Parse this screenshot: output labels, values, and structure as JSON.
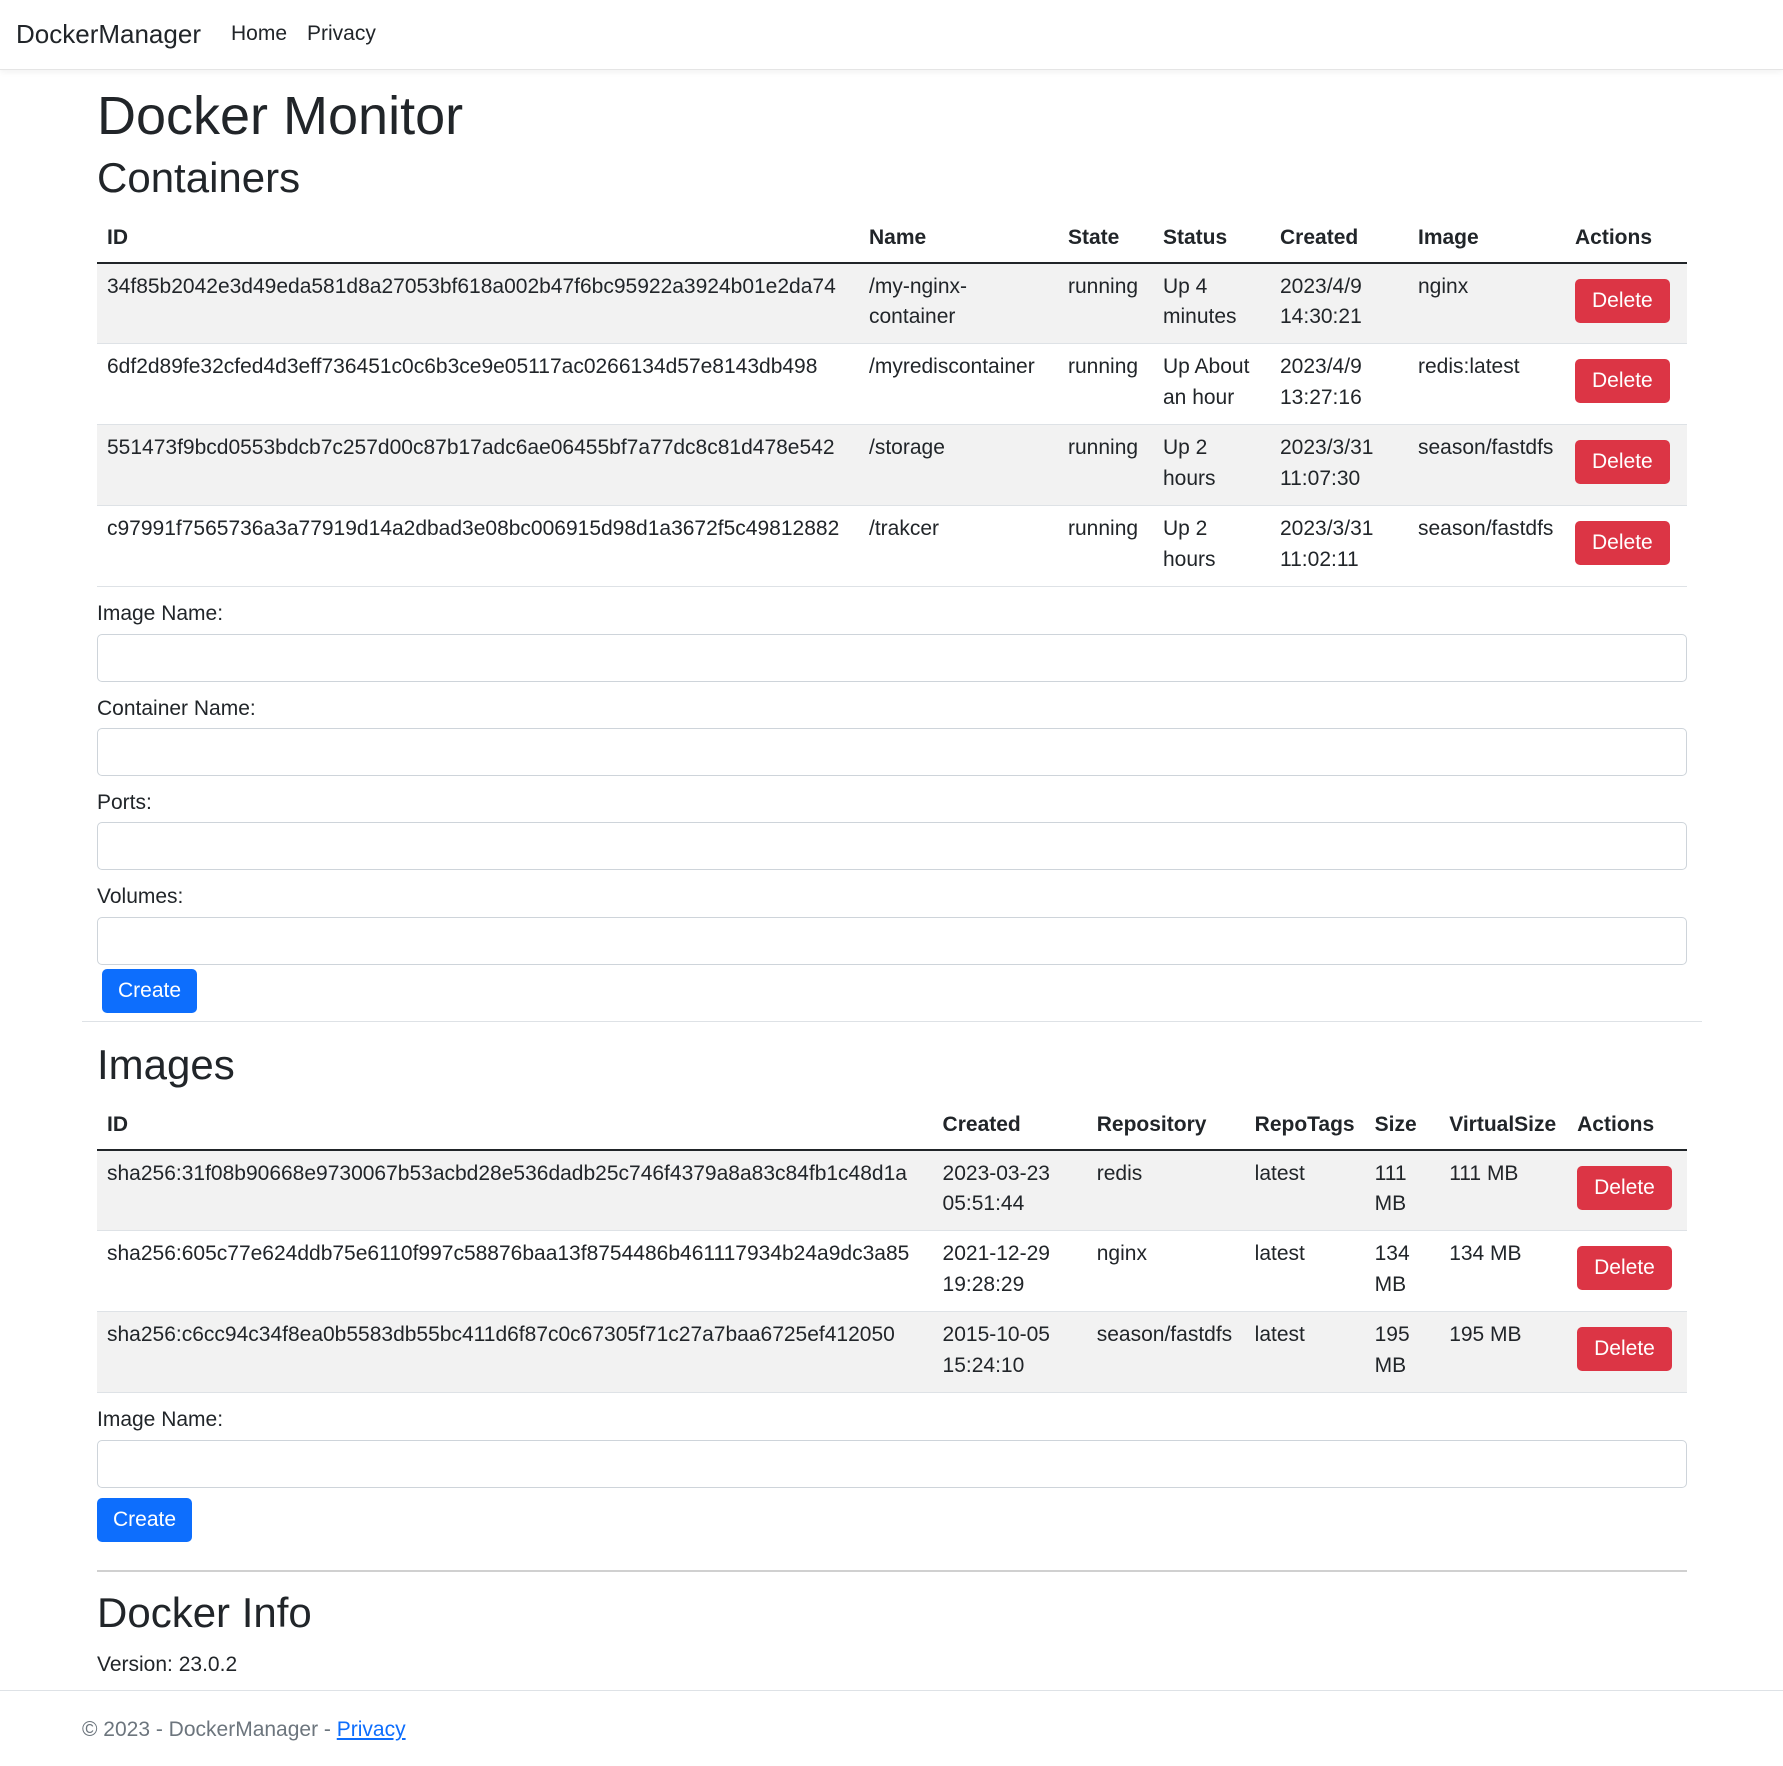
{
  "nav": {
    "brand": "DockerManager",
    "links": [
      "Home",
      "Privacy"
    ]
  },
  "page_title": "Docker Monitor",
  "containers": {
    "title": "Containers",
    "headers": [
      "ID",
      "Name",
      "State",
      "Status",
      "Created",
      "Image",
      "Actions"
    ],
    "rows": [
      {
        "id": "34f85b2042e3d49eda581d8a27053bf618a002b47f6bc95922a3924b01e2da74",
        "name": "/my-nginx-container",
        "state": "running",
        "status": "Up 4 minutes",
        "created": "2023/4/9 14:30:21",
        "image": "nginx",
        "action": "Delete"
      },
      {
        "id": "6df2d89fe32cfed4d3eff736451c0c6b3ce9e05117ac0266134d57e8143db498",
        "name": "/myrediscontainer",
        "state": "running",
        "status": "Up About an hour",
        "created": "2023/4/9 13:27:16",
        "image": "redis:latest",
        "action": "Delete"
      },
      {
        "id": "551473f9bcd0553bdcb7c257d00c87b17adc6ae06455bf7a77dc8c81d478e542",
        "name": "/storage",
        "state": "running",
        "status": "Up 2 hours",
        "created": "2023/3/31 11:07:30",
        "image": "season/fastdfs",
        "action": "Delete"
      },
      {
        "id": "c97991f7565736a3a77919d14a2dbad3e08bc006915d98d1a3672f5c49812882",
        "name": "/trakcer",
        "state": "running",
        "status": "Up 2 hours",
        "created": "2023/3/31 11:02:11",
        "image": "season/fastdfs",
        "action": "Delete"
      }
    ],
    "form": {
      "image_name_label": "Image Name:",
      "image_name_value": "",
      "container_name_label": "Container Name:",
      "container_name_value": "",
      "ports_label": "Ports:",
      "ports_value": "",
      "volumes_label": "Volumes:",
      "volumes_value": "",
      "create_label": "Create"
    }
  },
  "images": {
    "title": "Images",
    "headers": [
      "ID",
      "Created",
      "Repository",
      "RepoTags",
      "Size",
      "VirtualSize",
      "Actions"
    ],
    "rows": [
      {
        "id": "sha256:31f08b90668e9730067b53acbd28e536dadb25c746f4379a8a83c84fb1c48d1a",
        "created": "2023-03-23 05:51:44",
        "repository": "redis",
        "repotags": "latest",
        "size": "111 MB",
        "virtualsize": "111 MB",
        "action": "Delete"
      },
      {
        "id": "sha256:605c77e624ddb75e6110f997c58876baa13f8754486b461117934b24a9dc3a85",
        "created": "2021-12-29 19:28:29",
        "repository": "nginx",
        "repotags": "latest",
        "size": "134 MB",
        "virtualsize": "134 MB",
        "action": "Delete"
      },
      {
        "id": "sha256:c6cc94c34f8ea0b5583db55bc411d6f87c0c67305f71c27a7baa6725ef412050",
        "created": "2015-10-05 15:24:10",
        "repository": "season/fastdfs",
        "repotags": "latest",
        "size": "195 MB",
        "virtualsize": "195 MB",
        "action": "Delete"
      }
    ],
    "form": {
      "image_name_label": "Image Name:",
      "image_name_value": "",
      "create_label": "Create"
    }
  },
  "info": {
    "title": "Docker Info",
    "version_label": "Version:",
    "version": "23.0.2"
  },
  "footer": {
    "text": "© 2023 - DockerManager - ",
    "link": "Privacy"
  },
  "colors": {
    "primary": "#0d6efd",
    "danger": "#dc3545",
    "stripe": "#f2f2f2"
  }
}
